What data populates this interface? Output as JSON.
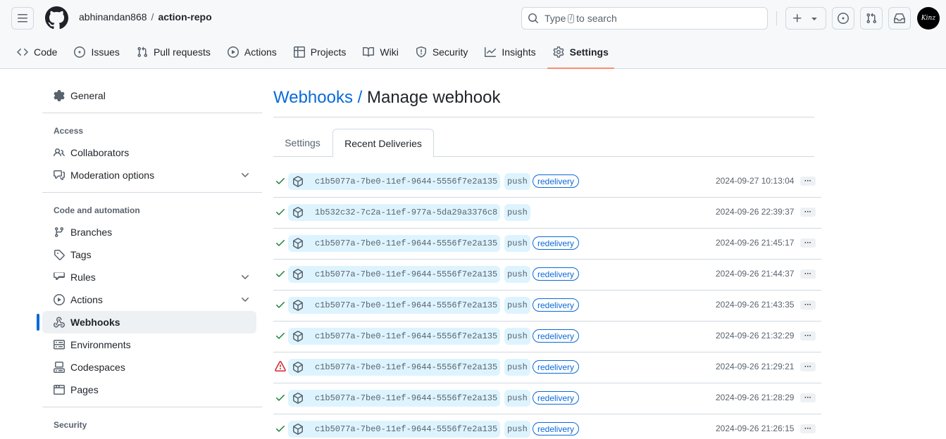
{
  "header": {
    "owner": "abhinandan868",
    "separator": "/",
    "repo": "action-repo",
    "search_prefix": "Type",
    "search_key": "/",
    "search_suffix": "to search",
    "avatar_text": "Kinz"
  },
  "repo_nav": [
    {
      "label": "Code",
      "icon": "code-icon"
    },
    {
      "label": "Issues",
      "icon": "issue-icon"
    },
    {
      "label": "Pull requests",
      "icon": "pull-request-icon"
    },
    {
      "label": "Actions",
      "icon": "play-icon"
    },
    {
      "label": "Projects",
      "icon": "table-icon"
    },
    {
      "label": "Wiki",
      "icon": "book-icon"
    },
    {
      "label": "Security",
      "icon": "shield-icon"
    },
    {
      "label": "Insights",
      "icon": "graph-icon"
    },
    {
      "label": "Settings",
      "icon": "gear-icon",
      "active": true
    }
  ],
  "sidebar": {
    "general": "General",
    "access_heading": "Access",
    "access_items": [
      {
        "label": "Collaborators",
        "icon": "people-icon"
      },
      {
        "label": "Moderation options",
        "icon": "comment-icon",
        "expandable": true
      }
    ],
    "code_heading": "Code and automation",
    "code_items": [
      {
        "label": "Branches",
        "icon": "branch-icon"
      },
      {
        "label": "Tags",
        "icon": "tag-icon"
      },
      {
        "label": "Rules",
        "icon": "rules-icon",
        "expandable": true
      },
      {
        "label": "Actions",
        "icon": "play-icon",
        "expandable": true
      },
      {
        "label": "Webhooks",
        "icon": "webhook-icon",
        "active": true
      },
      {
        "label": "Environments",
        "icon": "server-icon"
      },
      {
        "label": "Codespaces",
        "icon": "codespaces-icon"
      },
      {
        "label": "Pages",
        "icon": "browser-icon"
      }
    ],
    "security_heading": "Security"
  },
  "page": {
    "title_link": "Webhooks",
    "title_sep": "/",
    "title": "Manage webhook",
    "tabs": [
      "Settings",
      "Recent Deliveries"
    ],
    "active_tab": "Recent Deliveries"
  },
  "deliveries": [
    {
      "status": "success",
      "guid": "c1b5077a-7be0-11ef-9644-5556f7e2a135",
      "event": "push",
      "redelivery": "redelivery",
      "time": "2024-09-27 10:13:04"
    },
    {
      "status": "success",
      "guid": "1b532c32-7c2a-11ef-977a-5da29a3376c8",
      "event": "push",
      "redelivery": "",
      "time": "2024-09-26 22:39:37"
    },
    {
      "status": "success",
      "guid": "c1b5077a-7be0-11ef-9644-5556f7e2a135",
      "event": "push",
      "redelivery": "redelivery",
      "time": "2024-09-26 21:45:17"
    },
    {
      "status": "success",
      "guid": "c1b5077a-7be0-11ef-9644-5556f7e2a135",
      "event": "push",
      "redelivery": "redelivery",
      "time": "2024-09-26 21:44:37"
    },
    {
      "status": "success",
      "guid": "c1b5077a-7be0-11ef-9644-5556f7e2a135",
      "event": "push",
      "redelivery": "redelivery",
      "time": "2024-09-26 21:43:35"
    },
    {
      "status": "success",
      "guid": "c1b5077a-7be0-11ef-9644-5556f7e2a135",
      "event": "push",
      "redelivery": "redelivery",
      "time": "2024-09-26 21:32:29"
    },
    {
      "status": "failure",
      "guid": "c1b5077a-7be0-11ef-9644-5556f7e2a135",
      "event": "push",
      "redelivery": "redelivery",
      "time": "2024-09-26 21:29:21"
    },
    {
      "status": "success",
      "guid": "c1b5077a-7be0-11ef-9644-5556f7e2a135",
      "event": "push",
      "redelivery": "redelivery",
      "time": "2024-09-26 21:28:29"
    },
    {
      "status": "success",
      "guid": "c1b5077a-7be0-11ef-9644-5556f7e2a135",
      "event": "push",
      "redelivery": "redelivery",
      "time": "2024-09-26 21:26:15"
    }
  ],
  "more_label": "···",
  "colors": {
    "accent": "#0969da",
    "success": "#1a7f37",
    "danger": "#d1242f",
    "nav_underline": "#fd8c73"
  }
}
